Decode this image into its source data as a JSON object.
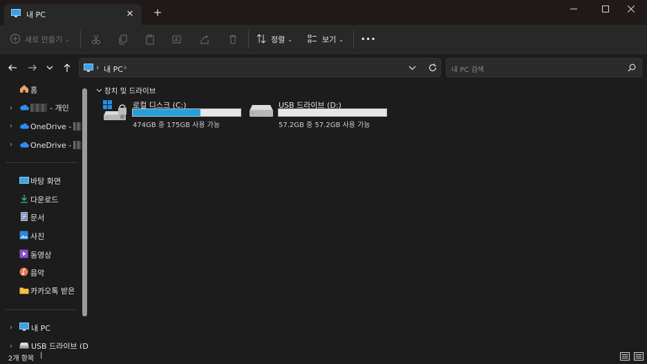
{
  "window": {
    "tab_title": "내 PC",
    "new_tab_symbol": "+",
    "close_tab_symbol": "✕"
  },
  "toolbar": {
    "new_label": "새로 만들기",
    "sort_label": "정렬",
    "view_label": "보기",
    "more_label": "•••"
  },
  "address": {
    "crumb": "내 PC",
    "search_placeholder": "내 PC 검색"
  },
  "sidebar": {
    "home": "홈",
    "personal": "- 개인",
    "onedrive1": "OneDrive -",
    "onedrive2": "OneDrive -",
    "quick": [
      {
        "label": "바탕 화면"
      },
      {
        "label": "다운로드"
      },
      {
        "label": "문서"
      },
      {
        "label": "사진"
      },
      {
        "label": "동영상"
      },
      {
        "label": "음악"
      },
      {
        "label": "카카오톡 받은"
      }
    ],
    "thispc": "내 PC",
    "usb": "USB 드라이브 (D"
  },
  "content": {
    "section_title": "장치 및 드라이브",
    "drives": [
      {
        "name": "로컬 디스크 (C:)",
        "usage": "474GB 중 175GB 사용 가능",
        "used_fraction": 0.63
      },
      {
        "name": "USB 드라이브 (D:)",
        "usage": "57.2GB 중 57.2GB 사용 가능",
        "used_fraction": 0.0
      }
    ]
  },
  "status": {
    "item_count": "2개 항목",
    "cursor": "|"
  },
  "colors": {
    "accent": "#26a0da",
    "onedrive": "#2b8ef0",
    "folder": "#f4c042"
  }
}
